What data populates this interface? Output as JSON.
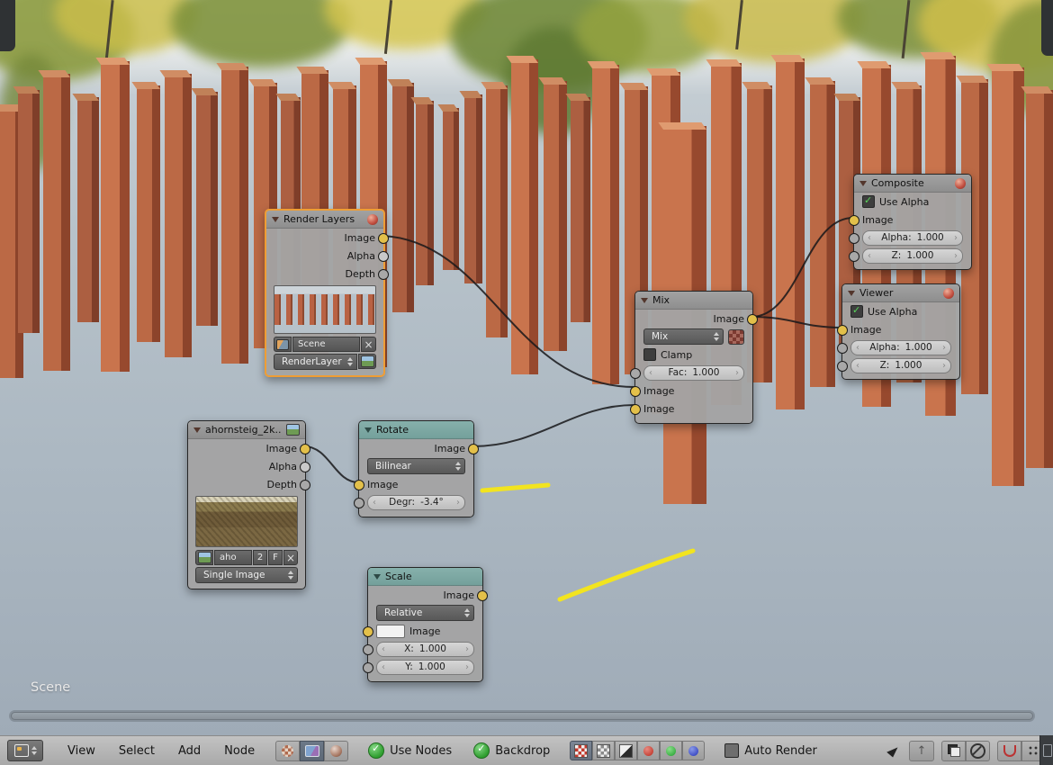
{
  "scene_label": "Scene",
  "nodes": {
    "render_layers": {
      "title": "Render Layers",
      "outputs": [
        "Image",
        "Alpha",
        "Depth"
      ],
      "scene_name": "Scene",
      "layer_name": "RenderLayer"
    },
    "image_node": {
      "title": "ahornsteig_2k...",
      "outputs": [
        "Image",
        "Alpha",
        "Depth"
      ],
      "file_short": "aho",
      "users": "2",
      "fake_user": "F",
      "source": "Single Image"
    },
    "rotate": {
      "title": "Rotate",
      "output": "Image",
      "filter": "Bilinear",
      "input": "Image",
      "degr_label": "Degr:",
      "degr_value": "-3.4°"
    },
    "scale": {
      "title": "Scale",
      "output": "Image",
      "space": "Relative",
      "input": "Image",
      "x_label": "X:",
      "x_value": "1.000",
      "y_label": "Y:",
      "y_value": "1.000"
    },
    "mix": {
      "title": "Mix",
      "output": "Image",
      "blend_mode": "Mix",
      "clamp_label": "Clamp",
      "fac_label": "Fac:",
      "fac_value": "1.000",
      "inputs": [
        "Image",
        "Image"
      ]
    },
    "composite": {
      "title": "Composite",
      "use_alpha": "Use Alpha",
      "input": "Image",
      "alpha_label": "Alpha:",
      "alpha_value": "1.000",
      "z_label": "Z:",
      "z_value": "1.000"
    },
    "viewer": {
      "title": "Viewer",
      "use_alpha": "Use Alpha",
      "input": "Image",
      "alpha_label": "Alpha:",
      "alpha_value": "1.000",
      "z_label": "Z:",
      "z_value": "1.000"
    }
  },
  "header": {
    "menus": [
      "View",
      "Select",
      "Add",
      "Node"
    ],
    "use_nodes": "Use Nodes",
    "backdrop": "Backdrop",
    "auto_render": "Auto Render"
  },
  "colors": {
    "accent_selected": "#ef9d34",
    "socket_image": "#e3c04a",
    "annotation": "#f2e41f",
    "pillar": "#bc6a47"
  }
}
